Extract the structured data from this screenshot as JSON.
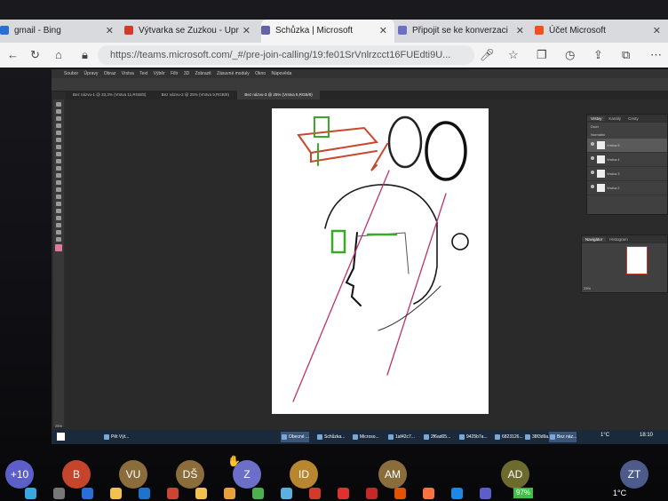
{
  "browser": {
    "tabs": [
      {
        "title": "gmail - Bing",
        "color": "#2b6fd6"
      },
      {
        "title": "Výtvarka se Zuzkou - Upr",
        "color": "#d23a2a"
      },
      {
        "title": "Schůzka | Microsoft",
        "color": "#6264a7"
      },
      {
        "title": "Připojit se ke konverzaci",
        "color": "#6b6fc8"
      },
      {
        "title": "Účet Microsoft",
        "color": "#f25022"
      }
    ],
    "url": "https://teams.microsoft.com/_#/pre-join-calling/19:fe01SrVnlrzcct16FUEdti9U..."
  },
  "photoshop": {
    "menu": [
      "Soubor",
      "Úpravy",
      "Obraz",
      "Vrstva",
      "Text",
      "Výběr",
      "Filtr",
      "3D",
      "Zobrazit",
      "Zásuvné moduly",
      "Okno",
      "Nápověda"
    ],
    "doc_tabs": [
      "Bez názvu-1 @ 33,3% (Vrstva 11,RGB/8)",
      "Bez názvu-2 @ 25% (Vrstva 9,RGB/8)",
      "Bez názvu-3 @ 25% (Vrstva 5,RGB/8)"
    ],
    "panels": {
      "character_tabs": [
        "Znaky",
        "Odstavec"
      ],
      "color_tabs": [
        "Barvy",
        "Vzorník",
        "Přechody",
        "Vzorky"
      ],
      "swatch_search": "Vyhledat vzorník",
      "adjust_tabs": [
        "Vlastnosti",
        "Přizpůsobení"
      ],
      "adjust_title": "Přidat přizpůsobení",
      "properties_title": "Zdroj klonování",
      "layers_tabs": [
        "Vrstvy",
        "Kanály",
        "Cesty"
      ],
      "layers_kind": "Druh",
      "layers_blend": "Normální",
      "layers": [
        "Vrstva 5",
        "Vrstva 4",
        "Vrstva 3",
        "Vrstva 2"
      ],
      "navigator_tabs": [
        "Navigátor",
        "Histogram"
      ],
      "zoom": "25%",
      "status": "25%"
    }
  },
  "taskbar": {
    "items": [
      "Pět Výt...",
      "Obecné ...",
      "Schůzka...",
      "Microso...",
      "1af42c7...",
      "2f6ad05...",
      "9425b7a...",
      "6823126...",
      "38f3d9a...",
      "Bez náz..."
    ],
    "weather": "1°C",
    "time": "18:10"
  },
  "participants": [
    {
      "initials": "+10",
      "color": "#5b5fc7"
    },
    {
      "initials": "B",
      "color": "#c4452b"
    },
    {
      "initials": "VU",
      "color": "#8a6d3b"
    },
    {
      "initials": "DŠ",
      "color": "#8a6d3b"
    },
    {
      "initials": "Z",
      "color": "#6b6fc8"
    },
    {
      "initials": "ID",
      "color": "#b8862e"
    },
    {
      "initials": "AM",
      "color": "#8a6d3b"
    },
    {
      "initials": "AD",
      "color": "#6d6a2e"
    },
    {
      "initials": "ZT",
      "color": "#4c5b8a"
    }
  ],
  "system": {
    "battery": "97%",
    "temp": "1°C"
  }
}
